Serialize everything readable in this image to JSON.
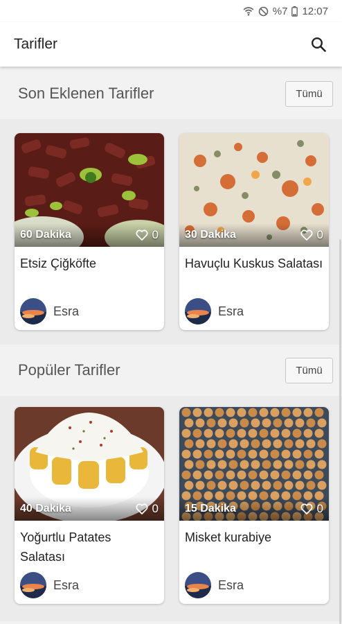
{
  "status_bar": {
    "battery": "%7",
    "time": "12:07"
  },
  "app_bar": {
    "title": "Tarifler"
  },
  "sections": [
    {
      "title": "Son Eklenen Tarifler",
      "all_label": "Tümü",
      "recipes": [
        {
          "duration": "60 Dakika",
          "likes": "0",
          "title": "Etsiz Çiğköfte",
          "author": "Esra"
        },
        {
          "duration": "30 Dakika",
          "likes": "0",
          "title": "Havuçlu Kuskus Salatası",
          "author": "Esra"
        }
      ]
    },
    {
      "title": "Popüler Tarifler",
      "all_label": "Tümü",
      "recipes": [
        {
          "duration": "40 Dakika",
          "likes": "0",
          "title": "Yoğurtlu Patates Salatası",
          "author": "Esra"
        },
        {
          "duration": "15 Dakika",
          "likes": "0",
          "title": "Misket kurabiye",
          "author": "Esra"
        }
      ]
    }
  ]
}
